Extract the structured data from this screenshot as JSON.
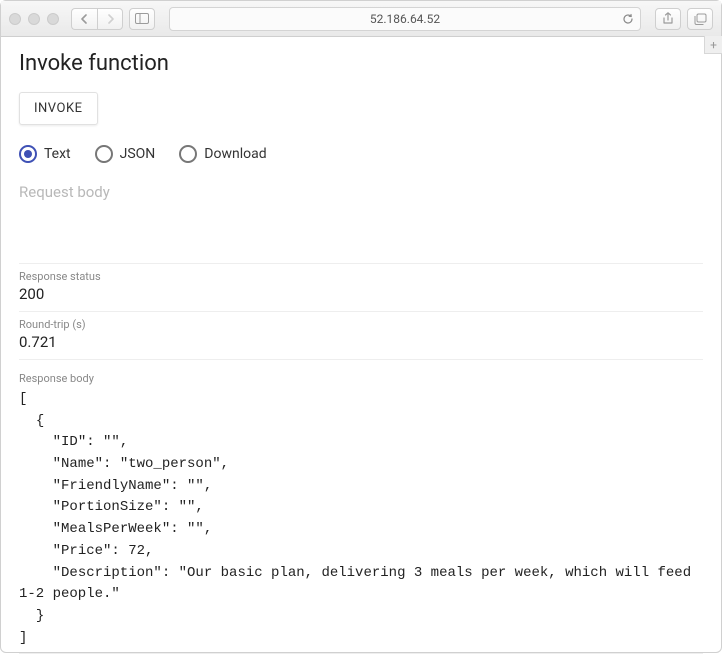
{
  "browser": {
    "address": "52.186.64.52"
  },
  "page": {
    "title": "Invoke function",
    "invoke_button": "INVOKE",
    "radios": {
      "text": "Text",
      "json": "JSON",
      "download": "Download"
    },
    "request_body_placeholder": "Request body",
    "response_status_label": "Response status",
    "response_status_value": "200",
    "roundtrip_label": "Round-trip (s)",
    "roundtrip_value": "0.721",
    "response_body_label": "Response body",
    "response_body_value": "[\n  {\n    \"ID\": \"\",\n    \"Name\": \"two_person\",\n    \"FriendlyName\": \"\",\n    \"PortionSize\": \"\",\n    \"MealsPerWeek\": \"\",\n    \"Price\": 72,\n    \"Description\": \"Our basic plan, delivering 3 meals per week, which will feed 1-2 people.\"\n  }\n]"
  }
}
